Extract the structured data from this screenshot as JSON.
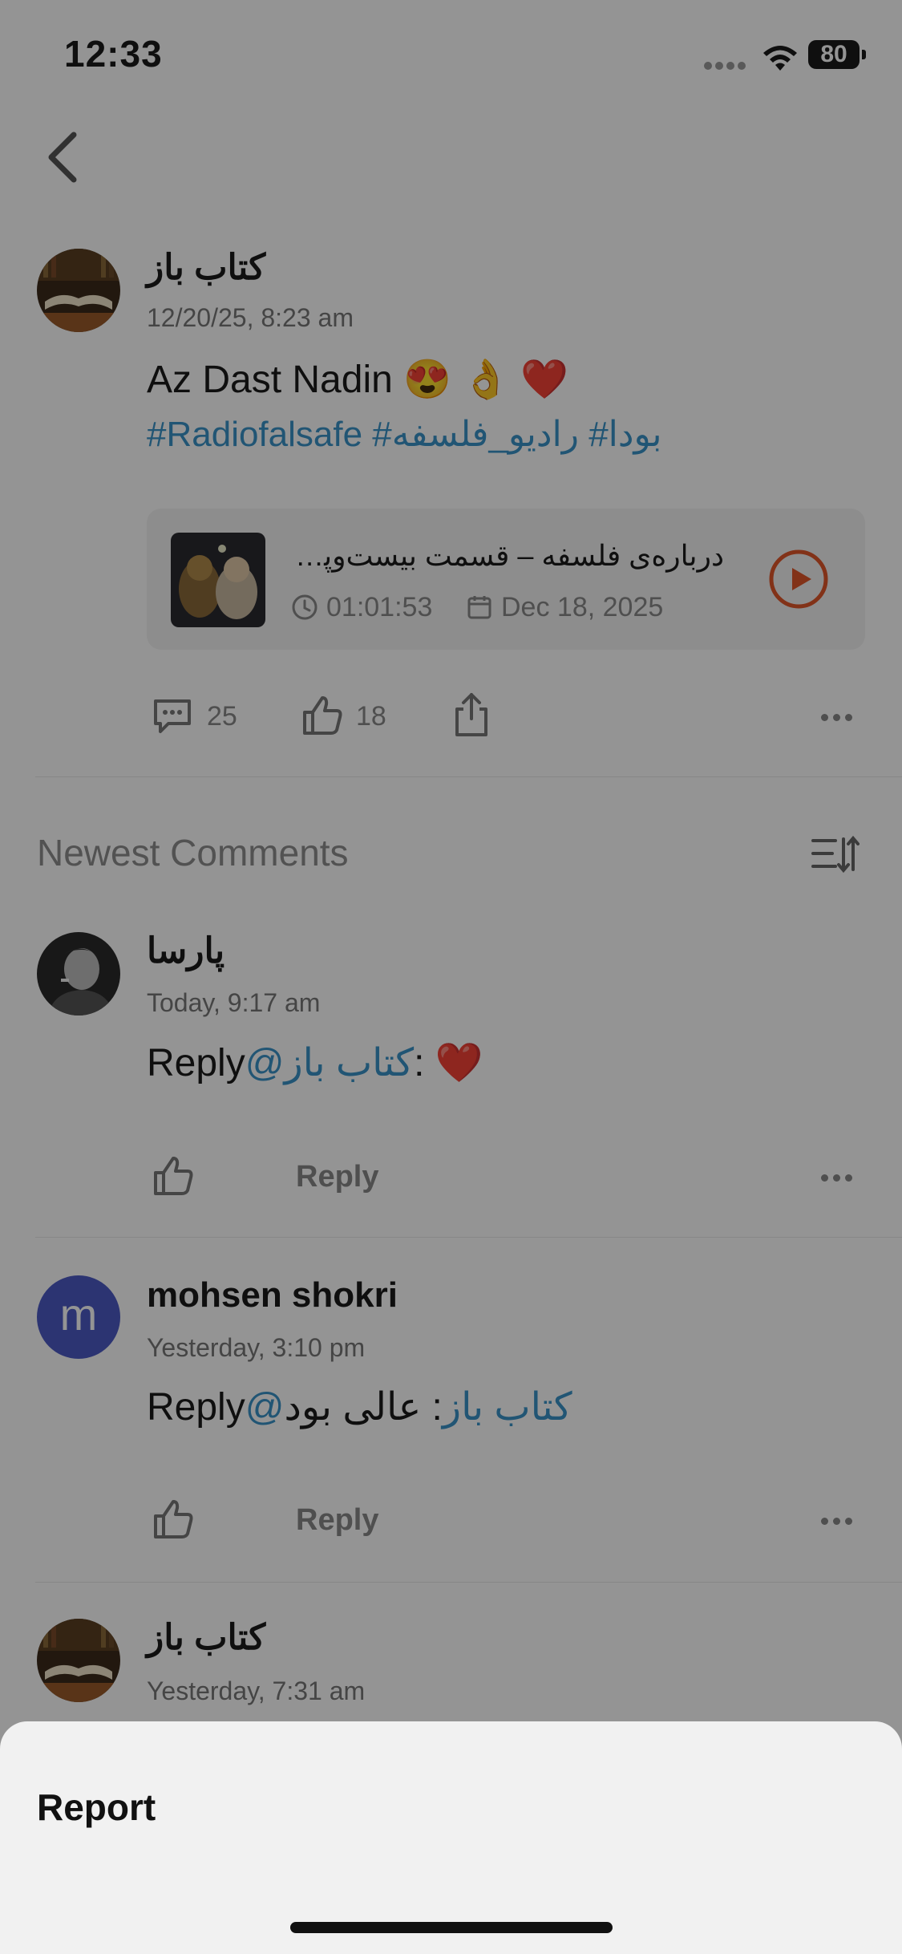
{
  "status_bar": {
    "time": "12:33",
    "battery": "80"
  },
  "post": {
    "author": "کتاب باز",
    "date": "12/20/25, 8:23 am",
    "text": "Az Dast Nadin",
    "emojis": "😍 👌 ❤️",
    "hashtags": "#Radiofalsafe #بودا# رادیو_فلسفه",
    "episode": {
      "title": "درباره‌ی فلسفه – قسمت بیست‌وپنجم",
      "duration": "01:01:53",
      "date": "Dec 18, 2025"
    },
    "comments_count": "25",
    "likes_count": "18"
  },
  "comments_section": {
    "title": "Newest Comments"
  },
  "comments": [
    {
      "author": "پارسا",
      "date": "Today, 9:17 am",
      "reply_prefix": "Reply",
      "mention": "@کتاب باز",
      "suffix": ": ",
      "emoji": "❤️",
      "reply_label": "Reply"
    },
    {
      "author": "mohsen shokri",
      "avatar_letter": "m",
      "date": "Yesterday, 3:10 pm",
      "reply_prefix": "Reply",
      "mention_at": "@",
      "rest": "کتاب باز",
      "reply_text": ": عالی بود",
      "reply_label": "Reply"
    },
    {
      "author": "کتاب باز",
      "date": "Yesterday, 7:31 am"
    }
  ],
  "sheet": {
    "report_label": "Report"
  },
  "colors": {
    "accent_link": "#3a93c8",
    "play": "#e0562a",
    "avatar_m": "#4d5bc4"
  },
  "icons": [
    "back-chevron-icon",
    "comment-icon",
    "like-icon",
    "share-icon",
    "more-icon",
    "sort-icon",
    "play-icon",
    "clock-icon",
    "calendar-icon",
    "wifi-icon"
  ]
}
